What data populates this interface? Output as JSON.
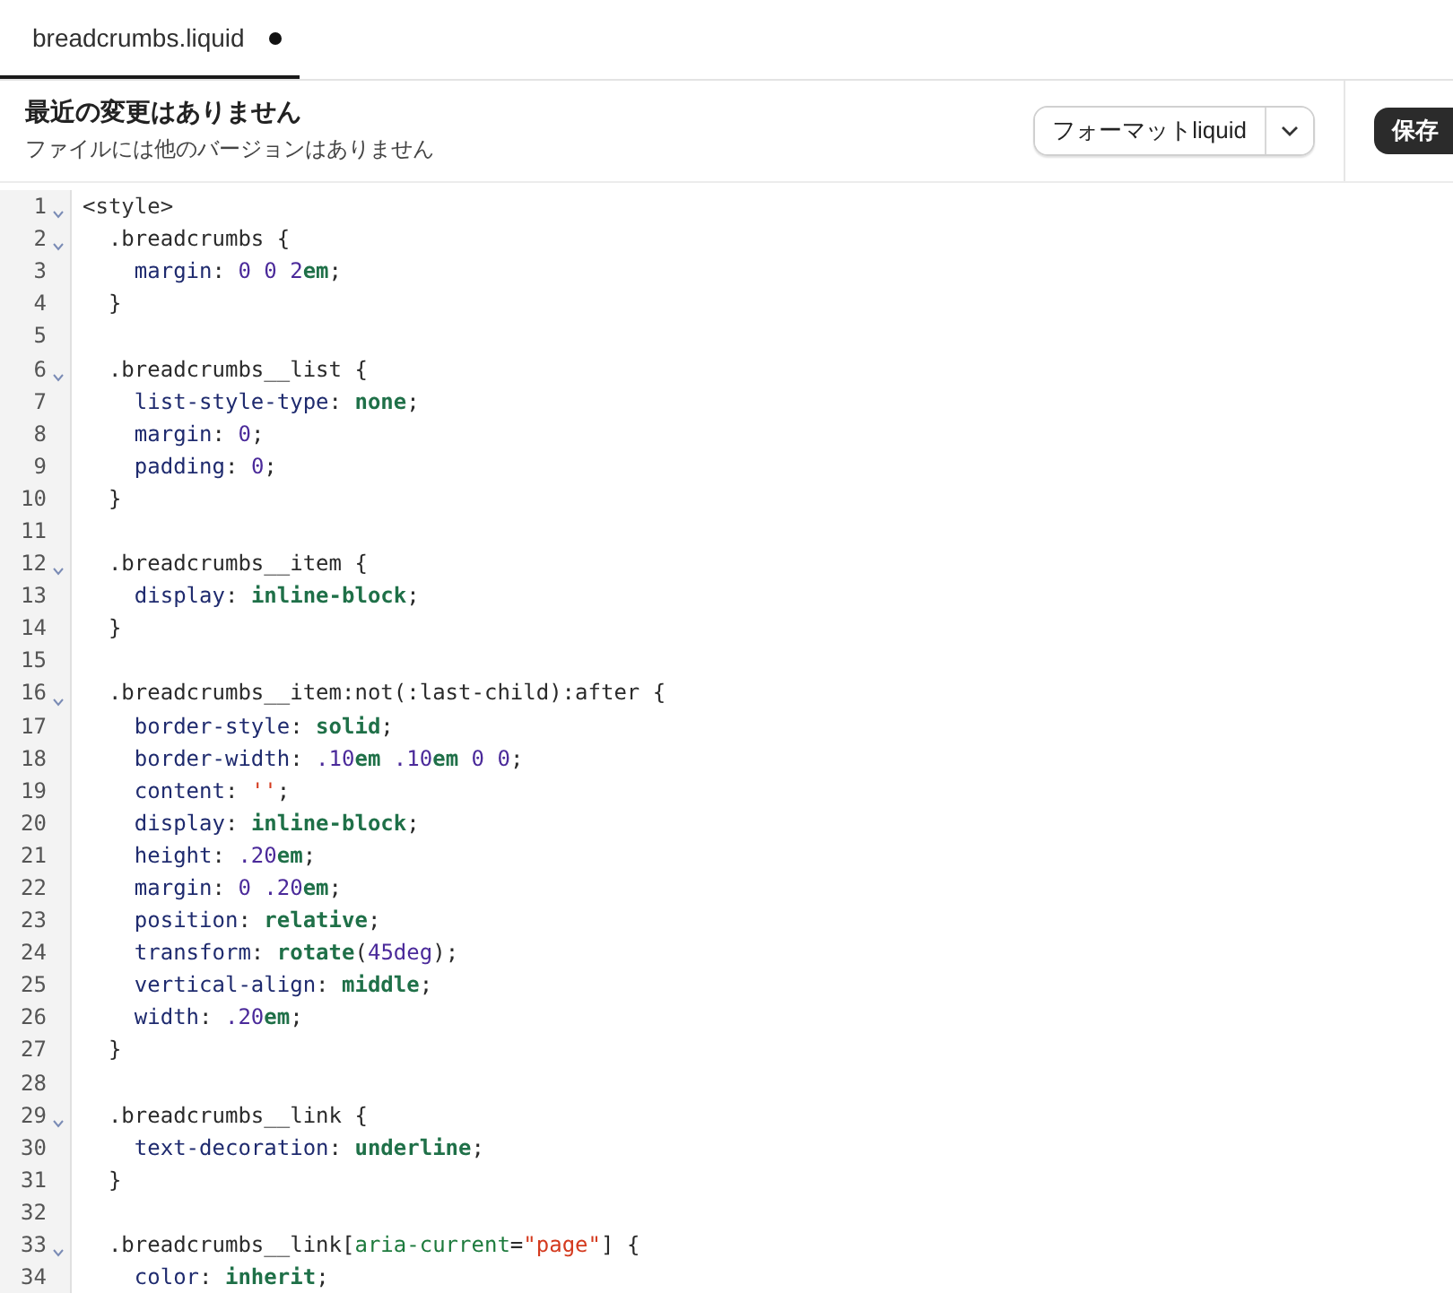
{
  "tabs": [
    {
      "label": "breadcrumbs.liquid",
      "selected": true,
      "unsaved": true
    }
  ],
  "header": {
    "title": "最近の変更はありません",
    "subtitle": "ファイルには他のバージョンはありません",
    "format_button": "フォーマットliquid",
    "save_button": "保存"
  },
  "code_lines": [
    {
      "number": "1",
      "foldable": true,
      "tokens": [
        {
          "kind": "tag",
          "text": "<style>"
        }
      ]
    },
    {
      "number": "2",
      "foldable": true,
      "tokens": [
        {
          "kind": "plain",
          "text": "  .breadcrumbs {"
        }
      ]
    },
    {
      "number": "3",
      "foldable": false,
      "tokens": [
        {
          "kind": "property",
          "text": "    margin"
        },
        {
          "kind": "plain",
          "text": ": "
        },
        {
          "kind": "number",
          "text": "0 0 2"
        },
        {
          "kind": "unit",
          "text": "em"
        },
        {
          "kind": "plain",
          "text": ";"
        }
      ]
    },
    {
      "number": "4",
      "foldable": false,
      "tokens": [
        {
          "kind": "plain",
          "text": "  }"
        }
      ]
    },
    {
      "number": "5",
      "foldable": false
    },
    {
      "number": "6",
      "foldable": true,
      "tokens": [
        {
          "kind": "plain",
          "text": "  .breadcrumbs__list {"
        }
      ]
    },
    {
      "number": "7",
      "foldable": false,
      "tokens": [
        {
          "kind": "property",
          "text": "    list-style-type"
        },
        {
          "kind": "plain",
          "text": ": "
        },
        {
          "kind": "keyword",
          "text": "none"
        },
        {
          "kind": "plain",
          "text": ";"
        }
      ]
    },
    {
      "number": "8",
      "foldable": false,
      "tokens": [
        {
          "kind": "property",
          "text": "    margin"
        },
        {
          "kind": "plain",
          "text": ": "
        },
        {
          "kind": "number",
          "text": "0"
        },
        {
          "kind": "plain",
          "text": ";"
        }
      ]
    },
    {
      "number": "9",
      "foldable": false,
      "tokens": [
        {
          "kind": "property",
          "text": "    padding"
        },
        {
          "kind": "plain",
          "text": ": "
        },
        {
          "kind": "number",
          "text": "0"
        },
        {
          "kind": "plain",
          "text": ";"
        }
      ]
    },
    {
      "number": "10",
      "foldable": false,
      "tokens": [
        {
          "kind": "plain",
          "text": "  }"
        }
      ]
    },
    {
      "number": "11",
      "foldable": false
    },
    {
      "number": "12",
      "foldable": true,
      "tokens": [
        {
          "kind": "plain",
          "text": "  .breadcrumbs__item {"
        }
      ]
    },
    {
      "number": "13",
      "foldable": false,
      "tokens": [
        {
          "kind": "property",
          "text": "    display"
        },
        {
          "kind": "plain",
          "text": ": "
        },
        {
          "kind": "keyword",
          "text": "inline-block"
        },
        {
          "kind": "plain",
          "text": ";"
        }
      ]
    },
    {
      "number": "14",
      "foldable": false,
      "tokens": [
        {
          "kind": "plain",
          "text": "  }"
        }
      ]
    },
    {
      "number": "15",
      "foldable": false
    },
    {
      "number": "16",
      "foldable": true,
      "tokens": [
        {
          "kind": "plain",
          "text": "  .breadcrumbs__item:not(:last-child):after {"
        }
      ]
    },
    {
      "number": "17",
      "foldable": false,
      "tokens": [
        {
          "kind": "property",
          "text": "    border-style"
        },
        {
          "kind": "plain",
          "text": ": "
        },
        {
          "kind": "keyword",
          "text": "solid"
        },
        {
          "kind": "plain",
          "text": ";"
        }
      ]
    },
    {
      "number": "18",
      "foldable": false,
      "tokens": [
        {
          "kind": "property",
          "text": "    border-width"
        },
        {
          "kind": "plain",
          "text": ": "
        },
        {
          "kind": "number",
          "text": ".10"
        },
        {
          "kind": "unit",
          "text": "em "
        },
        {
          "kind": "number",
          "text": ".10"
        },
        {
          "kind": "unit",
          "text": "em"
        },
        {
          "kind": "number",
          "text": " 0 0"
        },
        {
          "kind": "plain",
          "text": ";"
        }
      ]
    },
    {
      "number": "19",
      "foldable": false,
      "tokens": [
        {
          "kind": "property",
          "text": "    content"
        },
        {
          "kind": "plain",
          "text": ": "
        },
        {
          "kind": "string",
          "text": "''"
        },
        {
          "kind": "plain",
          "text": ";"
        }
      ]
    },
    {
      "number": "20",
      "foldable": false,
      "tokens": [
        {
          "kind": "property",
          "text": "    display"
        },
        {
          "kind": "plain",
          "text": ": "
        },
        {
          "kind": "keyword",
          "text": "inline-block"
        },
        {
          "kind": "plain",
          "text": ";"
        }
      ]
    },
    {
      "number": "21",
      "foldable": false,
      "tokens": [
        {
          "kind": "property",
          "text": "    height"
        },
        {
          "kind": "plain",
          "text": ": "
        },
        {
          "kind": "number",
          "text": ".20"
        },
        {
          "kind": "unit",
          "text": "em"
        },
        {
          "kind": "plain",
          "text": ";"
        }
      ]
    },
    {
      "number": "22",
      "foldable": false,
      "tokens": [
        {
          "kind": "property",
          "text": "    margin"
        },
        {
          "kind": "plain",
          "text": ": "
        },
        {
          "kind": "number",
          "text": "0 .20"
        },
        {
          "kind": "unit",
          "text": "em"
        },
        {
          "kind": "plain",
          "text": ";"
        }
      ]
    },
    {
      "number": "23",
      "foldable": false,
      "tokens": [
        {
          "kind": "property",
          "text": "    position"
        },
        {
          "kind": "plain",
          "text": ": "
        },
        {
          "kind": "keyword",
          "text": "relative"
        },
        {
          "kind": "plain",
          "text": ";"
        }
      ]
    },
    {
      "number": "24",
      "foldable": false,
      "tokens": [
        {
          "kind": "property",
          "text": "    transform"
        },
        {
          "kind": "plain",
          "text": ": "
        },
        {
          "kind": "keyword",
          "text": "rotate"
        },
        {
          "kind": "plain",
          "text": "("
        },
        {
          "kind": "number",
          "text": "45deg"
        },
        {
          "kind": "plain",
          "text": ");"
        }
      ]
    },
    {
      "number": "25",
      "foldable": false,
      "tokens": [
        {
          "kind": "property",
          "text": "    vertical-align"
        },
        {
          "kind": "plain",
          "text": ": "
        },
        {
          "kind": "keyword",
          "text": "middle"
        },
        {
          "kind": "plain",
          "text": ";"
        }
      ]
    },
    {
      "number": "26",
      "foldable": false,
      "tokens": [
        {
          "kind": "property",
          "text": "    width"
        },
        {
          "kind": "plain",
          "text": ": "
        },
        {
          "kind": "number",
          "text": ".20"
        },
        {
          "kind": "unit",
          "text": "em"
        },
        {
          "kind": "plain",
          "text": ";"
        }
      ]
    },
    {
      "number": "27",
      "foldable": false,
      "tokens": [
        {
          "kind": "plain",
          "text": "  }"
        }
      ]
    },
    {
      "number": "28",
      "foldable": false
    },
    {
      "number": "29",
      "foldable": true,
      "tokens": [
        {
          "kind": "plain",
          "text": "  .breadcrumbs__link {"
        }
      ]
    },
    {
      "number": "30",
      "foldable": false,
      "tokens": [
        {
          "kind": "property",
          "text": "    text-decoration"
        },
        {
          "kind": "plain",
          "text": ": "
        },
        {
          "kind": "keyword",
          "text": "underline"
        },
        {
          "kind": "plain",
          "text": ";"
        }
      ]
    },
    {
      "number": "31",
      "foldable": false,
      "tokens": [
        {
          "kind": "plain",
          "text": "  }"
        }
      ]
    },
    {
      "number": "32",
      "foldable": false
    },
    {
      "number": "33",
      "foldable": true,
      "tokens": [
        {
          "kind": "plain",
          "text": "  .breadcrumbs__link["
        },
        {
          "kind": "attribute",
          "text": "aria-current"
        },
        {
          "kind": "plain",
          "text": "="
        },
        {
          "kind": "string",
          "text": "\"page\""
        },
        {
          "kind": "plain",
          "text": "] {"
        }
      ]
    },
    {
      "number": "34",
      "foldable": false,
      "tokens": [
        {
          "kind": "property",
          "text": "    color"
        },
        {
          "kind": "plain",
          "text": ": "
        },
        {
          "kind": "keyword",
          "text": "inherit"
        },
        {
          "kind": "plain",
          "text": ";"
        }
      ]
    }
  ]
}
